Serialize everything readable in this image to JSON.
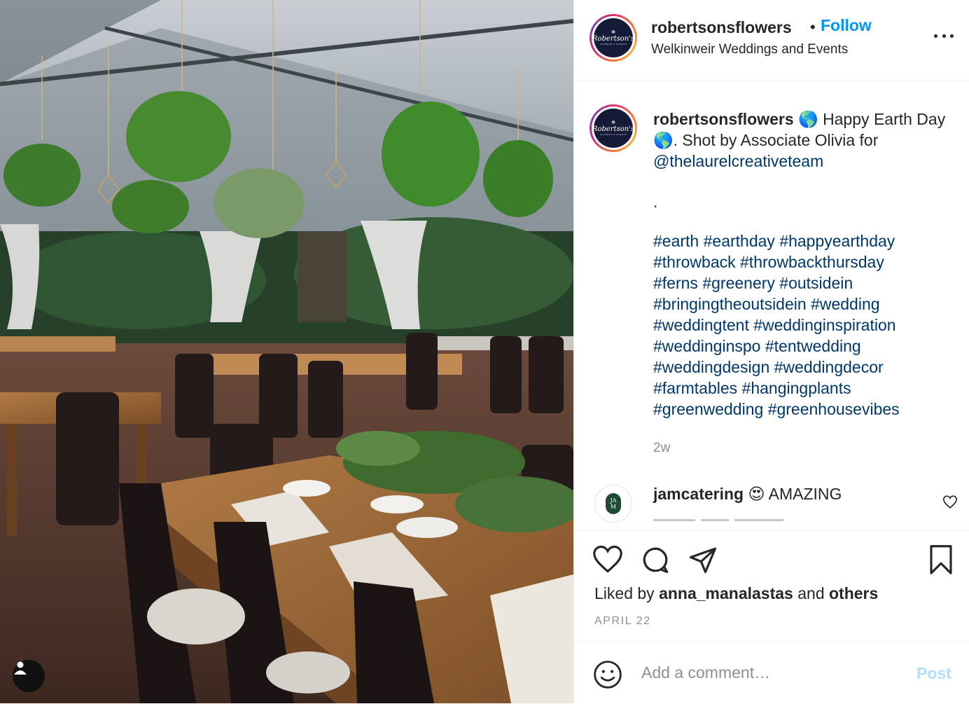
{
  "header": {
    "username": "robertsonsflowers",
    "separator": "•",
    "follow_label": "Follow",
    "location": "Welkinweir Weddings and Events",
    "avatar_logo": "Robertson's",
    "avatar_subtitle": "FLOWERS & EVENTS"
  },
  "caption": {
    "username": "robertsonsflowers",
    "text_part1": " 🌎 Happy Earth Day 🌎. Shot by Associate Olivia for ",
    "mention": "@thelaurelcreativeteam",
    "dot": ".",
    "hashtags": [
      "#earth",
      "#earthday",
      "#happyearthday",
      "#throwback",
      "#throwbackthursday",
      "#ferns",
      "#greenery",
      "#outsidein",
      "#bringingtheoutsidein",
      "#wedding",
      "#weddingtent",
      "#weddinginspiration",
      "#weddinginspo",
      "#tentwedding",
      "#weddingdesign",
      "#weddingdecor",
      "#farmtables",
      "#hangingplants",
      "#greenwedding",
      "#greenhousevibes"
    ],
    "time_ago": "2w"
  },
  "comment": {
    "username": "jamcatering",
    "text": " 😍 AMAZING",
    "avatar_initials_top": "JA",
    "avatar_initials_bottom": "M"
  },
  "actions": {
    "liked_by_prefix": "Liked by ",
    "liked_by_user": "anna_manalastas",
    "liked_by_middle": " and ",
    "liked_by_others": "others",
    "date": "APRIL 22"
  },
  "add_comment": {
    "placeholder": "Add a comment…",
    "post_label": "Post"
  },
  "icons": {
    "like": "heart-icon",
    "comment": "comment-bubble-icon",
    "share": "paper-plane-icon",
    "save": "bookmark-icon",
    "emoji": "smiley-icon",
    "more": "ellipsis-icon",
    "tag": "user-tag-icon"
  },
  "colors": {
    "follow_blue": "#0095f6",
    "link_navy": "#00376b",
    "muted_gray": "#8e8e8e",
    "post_disabled": "#b2dffc"
  }
}
